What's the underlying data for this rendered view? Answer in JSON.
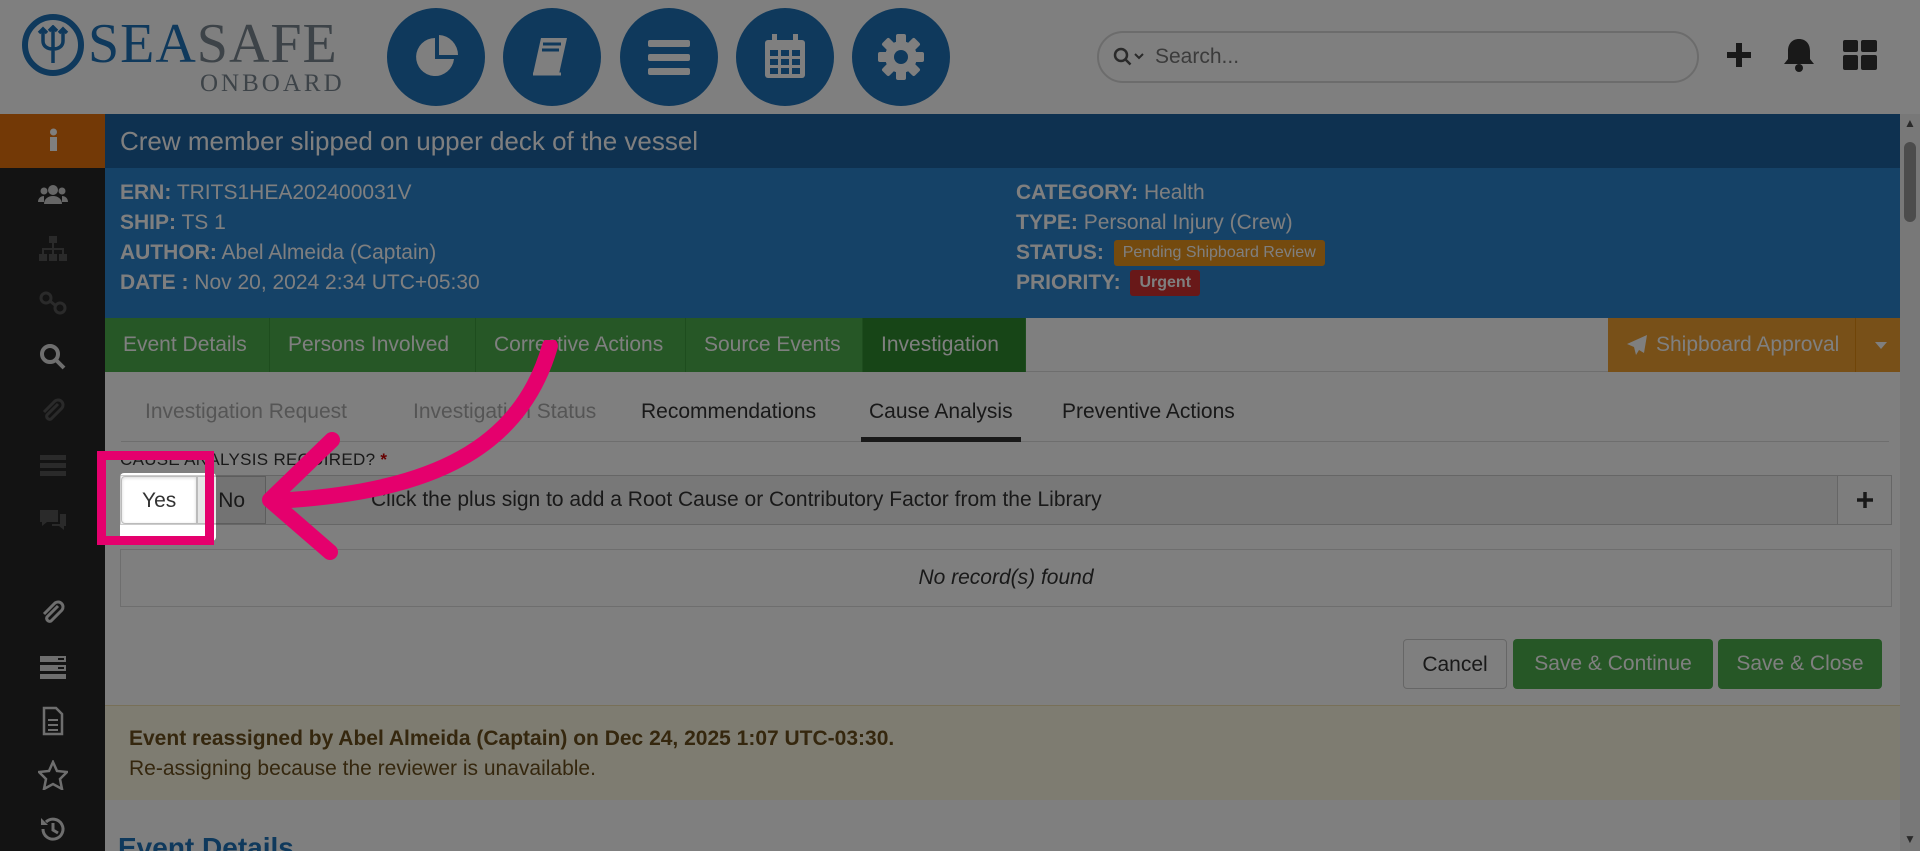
{
  "brand": {
    "sea": "SEA",
    "safe": "SAFE",
    "onboard": "ONBOARD"
  },
  "topnav": {
    "buttons": [
      "dashboard-pie-icon",
      "book-icon",
      "menu-icon",
      "calendar-icon",
      "gear-icon"
    ],
    "search_placeholder": "Search..."
  },
  "event": {
    "title": "Crew member slipped on upper deck of the vessel",
    "ern_label": "ERN:",
    "ern": "TRITS1HEA202400031V",
    "ship_label": "SHIP:",
    "ship": "TS 1",
    "author_label": "AUTHOR:",
    "author": "Abel Almeida (Captain)",
    "date_label": "DATE :",
    "date": "Nov 20, 2024 2:34 UTC+05:30",
    "category_label": "CATEGORY:",
    "category": "Health",
    "type_label": "TYPE:",
    "type": "Personal Injury (Crew)",
    "status_label": "STATUS:",
    "status": "Pending Shipboard Review",
    "priority_label": "PRIORITY:",
    "priority": "Urgent"
  },
  "tabs": [
    "Event Details",
    "Persons Involved",
    "Corrective Actions",
    "Source Events",
    "Investigation"
  ],
  "approve_label": "Shipboard Approval",
  "subtabs": [
    "Investigation Request",
    "Investigation Status",
    "Recommendations",
    "Cause Analysis",
    "Preventive Actions"
  ],
  "cause": {
    "question": "CAUSE ANALYSIS REQUIRED?",
    "required_mark": "*",
    "yes": "Yes",
    "no": "No",
    "hint": "Click the plus sign to add a Root Cause or Contributory Factor from the Library",
    "no_records": "No record(s) found"
  },
  "actions": {
    "cancel": "Cancel",
    "save_continue": "Save & Continue",
    "save_close": "Save & Close"
  },
  "notice": {
    "title": "Event reassigned by Abel Almeida (Captain) on Dec 24, 2025 1:07 UTC-03:30.",
    "body": "Re-assigning because the reviewer is unavailable."
  },
  "section_heading": "Event Details",
  "colors": {
    "primary": "#1f72b8",
    "green": "#4cae4c",
    "orange": "#f0a030",
    "highlight": "#e5006d"
  }
}
